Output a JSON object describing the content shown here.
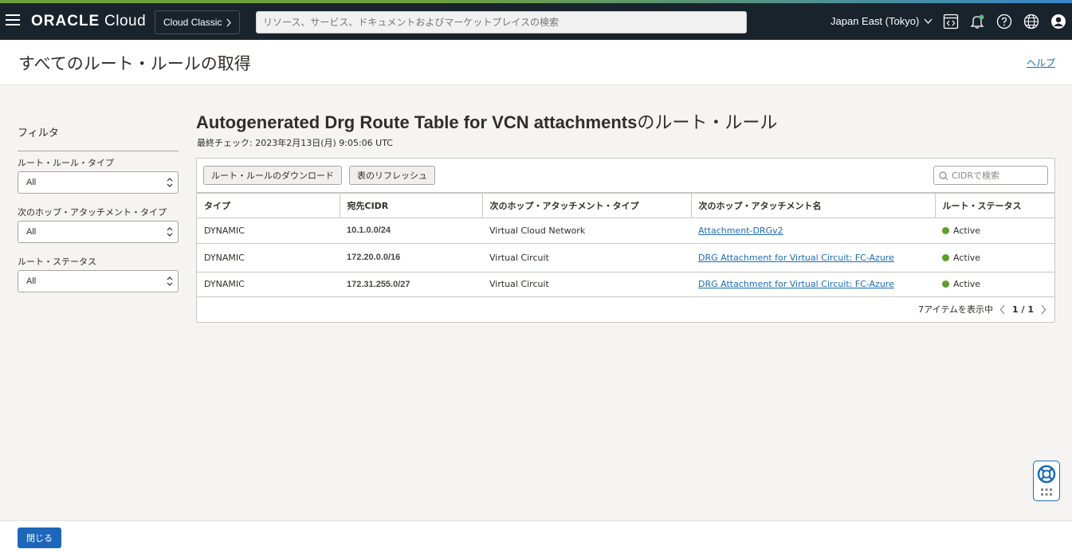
{
  "topbar": {
    "brand_bold": "ORACLE",
    "brand_light": " Cloud",
    "cloud_classic": "Cloud Classic",
    "search_placeholder": "リソース、サービス、ドキュメントおよびマーケットプレイスの検索",
    "region": "Japan East (Tokyo)"
  },
  "header": {
    "title": "すべてのルート・ルールの取得",
    "help": "ヘルプ"
  },
  "filters": {
    "title": "フィルタ",
    "groups": [
      {
        "label": "ルート・ルール・タイプ",
        "value": "All"
      },
      {
        "label": "次のホップ・アタッチメント・タイプ",
        "value": "All"
      },
      {
        "label": "ルート・ステータス",
        "value": "All"
      }
    ]
  },
  "main": {
    "title_bold": "Autogenerated Drg Route Table for VCN attachments",
    "title_suffix": "のルート・ルール",
    "last_check": "最終チェック: 2023年2月13日(月) 9:05:06 UTC",
    "download_button": "ルート・ルールのダウンロード",
    "refresh_button": "表のリフレッシュ",
    "cidr_search_placeholder": "CIDRで検索",
    "columns": [
      "タイプ",
      "宛先CIDR",
      "次のホップ・アタッチメント・タイプ",
      "次のホップ・アタッチメント名",
      "ルート・ステータス"
    ],
    "rows": [
      {
        "type": "DYNAMIC",
        "cidr": "10.1.0.0/24",
        "hop_type": "Virtual Cloud Network",
        "hop_name": "Attachment-DRGv2",
        "status": "Active"
      },
      {
        "type": "DYNAMIC",
        "cidr": "172.20.0.0/16",
        "hop_type": "Virtual Circuit",
        "hop_name": "DRG Attachment for Virtual Circuit: FC-Azure",
        "status": "Active"
      },
      {
        "type": "DYNAMIC",
        "cidr": "172.31.255.0/27",
        "hop_type": "Virtual Circuit",
        "hop_name": "DRG Attachment for Virtual Circuit: FC-Azure",
        "status": "Active"
      }
    ],
    "items_shown": "7アイテムを表示中",
    "page_indicator": "1 / 1"
  },
  "footer": {
    "close_button": "閉じる"
  },
  "colors": {
    "topbar": "#19232c",
    "link": "#1c6cb5",
    "primary_button": "#1d67ba",
    "status_active": "#5c9e2b"
  },
  "icons": [
    "hamburger-menu-icon",
    "chevron-right-icon",
    "chevron-down-icon",
    "code-editor-icon",
    "bell-icon",
    "help-circle-icon",
    "globe-icon",
    "user-avatar-icon",
    "search-icon",
    "chevron-left-icon",
    "lifebuoy-icon",
    "grid-dots-icon"
  ]
}
